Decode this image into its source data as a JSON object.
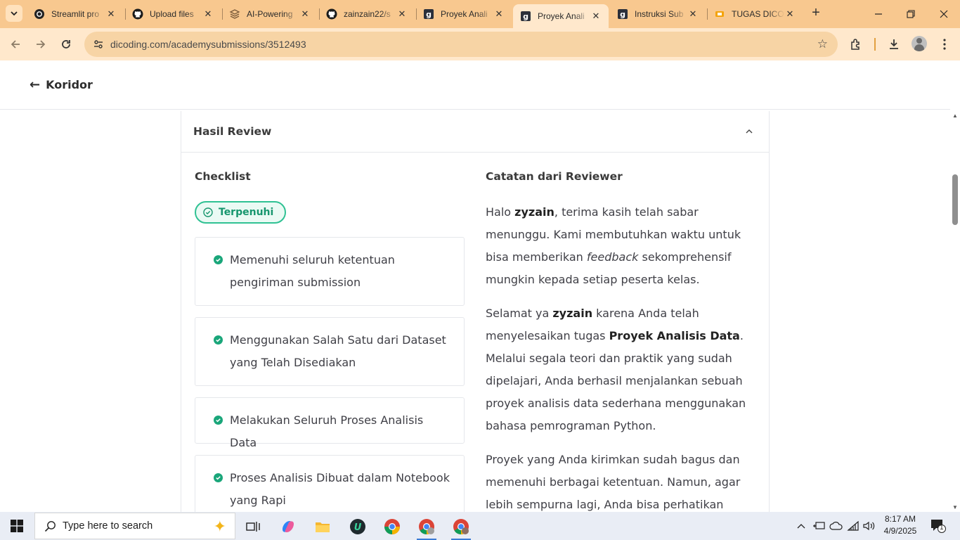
{
  "browser": {
    "tabs": [
      {
        "title": "Streamlit pro",
        "icon": "streamlit-icon"
      },
      {
        "title": "Upload files",
        "icon": "github-icon"
      },
      {
        "title": "AI-Powering",
        "icon": "layers-icon"
      },
      {
        "title": "zainzain22/s",
        "icon": "github-icon"
      },
      {
        "title": "Proyek Anali",
        "icon": "dicoding-icon"
      },
      {
        "title": "Proyek Anali",
        "icon": "dicoding-icon",
        "active": true
      },
      {
        "title": "Instruksi Sub",
        "icon": "dicoding-icon"
      },
      {
        "title": "TUGAS DICO",
        "icon": "slides-icon"
      }
    ],
    "url": "dicoding.com/academysubmissions/3512493",
    "theme_color": "#f8c88f"
  },
  "page": {
    "back_label": "Koridor",
    "card_title": "Hasil Review",
    "checklist": {
      "title": "Checklist",
      "status": "Terpenuhi",
      "items": [
        "Memenuhi seluruh ketentuan pengiriman submission",
        "Menggunakan Salah Satu dari Dataset yang Telah Disediakan",
        "Melakukan Seluruh Proses Analisis Data",
        "Proses Analisis Dibuat dalam Notebook yang Rapi"
      ]
    },
    "notes": {
      "title": "Catatan dari Reviewer",
      "p1": {
        "a": "Halo ",
        "name": "zyzain",
        "b": ", terima kasih telah sabar menunggu. Kami membutuhkan waktu untuk bisa memberikan ",
        "em": "feedback",
        "c": " sekomprehensif mungkin kepada setiap peserta kelas."
      },
      "p2": {
        "a": "Selamat ya ",
        "name": "zyzain",
        "b": " karena Anda telah menyelesaikan tugas ",
        "project": "Proyek Analisis Data",
        "c": ". Melalui segala teori dan praktik yang sudah dipelajari, Anda berhasil menjalankan sebuah proyek analisis data sederhana menggunakan bahasa pemrograman Python."
      },
      "p3": "Proyek yang Anda kirimkan sudah bagus dan memenuhi berbagai ketentuan. Namun, agar lebih sempurna lagi, Anda bisa perhatikan beberapa"
    },
    "accent_color": "#2fc193"
  },
  "taskbar": {
    "search_placeholder": "Type here to search",
    "time": "8:17 AM",
    "date": "4/9/2025",
    "notification_count": "1"
  }
}
